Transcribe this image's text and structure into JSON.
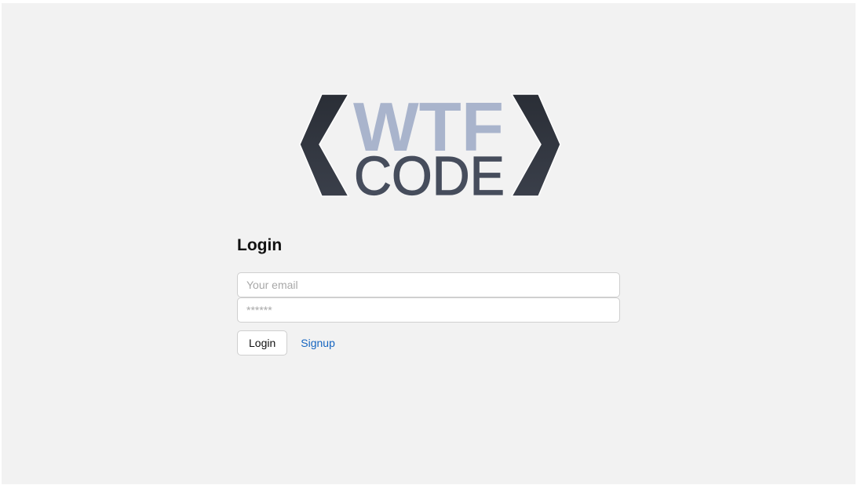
{
  "logo": {
    "line1": "WTF",
    "line2": "CODE",
    "colors": {
      "brackets": "#2e323b",
      "wtf": "#a9b4cc",
      "code": "#464d5c"
    }
  },
  "login_form": {
    "title": "Login",
    "email_placeholder": "Your email",
    "password_placeholder": "******",
    "login_button_label": "Login",
    "signup_link_label": "Signup"
  },
  "colors": {
    "page_background": "#f2f2f2",
    "link": "#1565c0"
  }
}
